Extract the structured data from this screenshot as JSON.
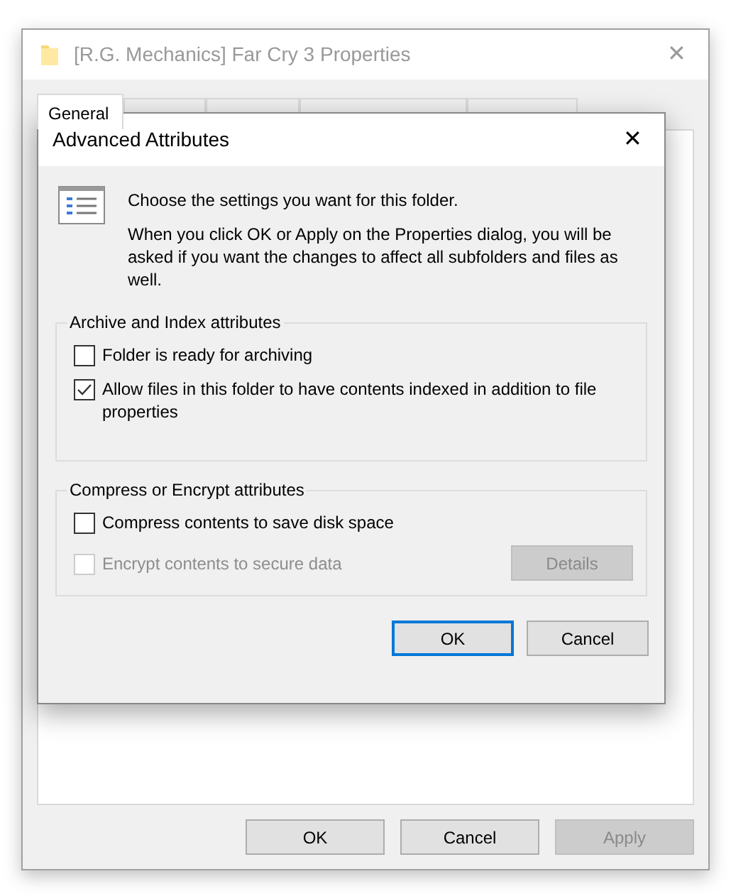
{
  "window": {
    "title": "[R.G. Mechanics] Far Cry 3 Properties",
    "close": "✕"
  },
  "tabs": [
    {
      "label": "General",
      "selected": true
    },
    {
      "selected": false
    },
    {
      "selected": false
    },
    {
      "selected": false
    },
    {
      "selected": false
    }
  ],
  "buttons": [
    {
      "label": "OK",
      "disabled": false
    },
    {
      "label": "Cancel",
      "disabled": false
    },
    {
      "label": "Apply",
      "disabled": true
    }
  ],
  "dialog": {
    "title": "Advanced Attributes",
    "close": "✕",
    "intro": "Choose the settings you want for this folder.",
    "note": "When you click OK or Apply on the Properties dialog, you will be asked if you want the changes to affect all subfolders and files as well.",
    "groups": [
      {
        "title": "Archive and Index attributes",
        "options": [
          {
            "label": "Folder is ready for archiving",
            "checked": false,
            "disabled": false
          },
          {
            "label": "Allow files in this folder to have contents indexed in addition to file properties",
            "checked": true,
            "disabled": false
          }
        ]
      },
      {
        "title": "Compress or Encrypt attributes",
        "options": [
          {
            "label": "Compress contents to save disk space",
            "checked": false,
            "disabled": false
          },
          {
            "label": "Encrypt contents to secure data",
            "checked": false,
            "disabled": true
          }
        ],
        "details": {
          "label": "Details",
          "disabled": true
        }
      }
    ],
    "buttons": [
      {
        "label": "OK",
        "default": true
      },
      {
        "label": "Cancel",
        "default": false
      }
    ]
  }
}
